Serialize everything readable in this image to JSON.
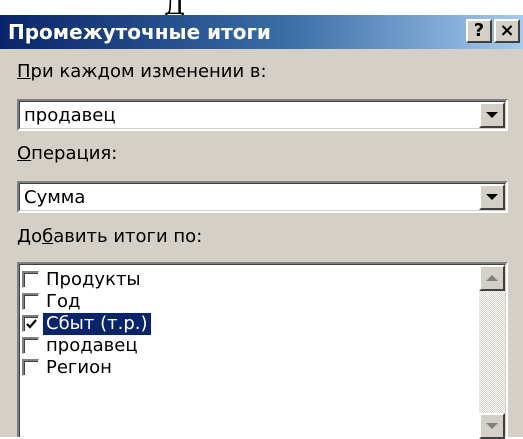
{
  "top_fragment": "Д",
  "window": {
    "title": "Промежуточные итоги",
    "help_glyph": "?",
    "close_glyph": "×"
  },
  "group_by": {
    "label_accel": "П",
    "label_rest": "ри каждом изменении в:",
    "value": "продавец"
  },
  "operation": {
    "label_accel": "О",
    "label_rest": "перация:",
    "value": "Сумма"
  },
  "add_totals": {
    "label_pre": "До",
    "label_accel": "б",
    "label_post": "авить итоги по:",
    "items": [
      {
        "label": "Продукты",
        "checked": false,
        "selected": false
      },
      {
        "label": "Год",
        "checked": false,
        "selected": false
      },
      {
        "label": "Сбыт (т.р.)",
        "checked": true,
        "selected": true
      },
      {
        "label": "продавец",
        "checked": false,
        "selected": false
      },
      {
        "label": "Регион",
        "checked": false,
        "selected": false
      }
    ]
  },
  "colors": {
    "title_gradient_start": "#0a246a",
    "title_gradient_end": "#a6caf0",
    "selection": "#0a246a",
    "face": "#d4d0c8"
  }
}
